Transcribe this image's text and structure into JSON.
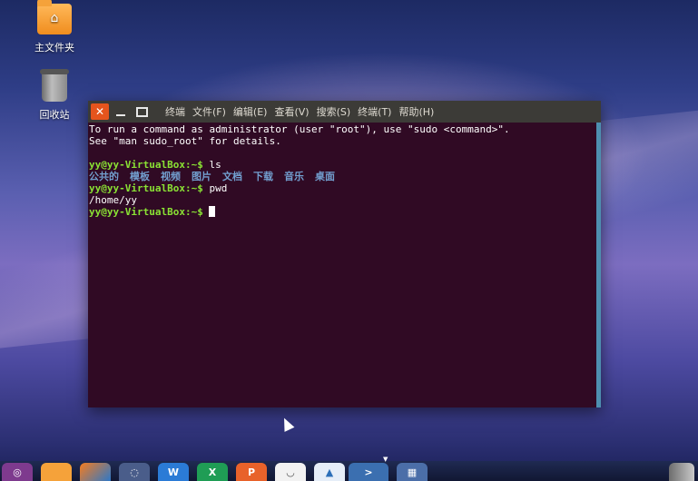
{
  "desktop": {
    "icons": [
      {
        "label": "主文件夹"
      },
      {
        "label": "回收站"
      }
    ]
  },
  "terminal": {
    "title_menu": [
      "终端",
      "文件(F)",
      "编辑(E)",
      "查看(V)",
      "搜索(S)",
      "终端(T)",
      "帮助(H)"
    ],
    "lines": {
      "l1": "To run a command as administrator (user \"root\"), use \"sudo <command>\".",
      "l2": "See \"man sudo_root\" for details.",
      "prompt": "yy@yy-VirtualBox:~$",
      "cmd1": " ls",
      "cmd2": " pwd",
      "pwd_out": "/home/yy",
      "cmd3": " "
    },
    "ls_dirs": [
      "公共的",
      "模板",
      "视频",
      "图片",
      "文档",
      "下载",
      "音乐",
      "桌面"
    ],
    "colors": {
      "background": "#300a24",
      "prompt": "#8ae234",
      "directory": "#729fcf",
      "close_button": "#e5541d"
    }
  },
  "dock": {
    "icons": [
      "ubuntu-icon",
      "files-icon",
      "firefox-icon",
      "settings-icon",
      "word-icon",
      "excel-icon",
      "powerpoint-icon",
      "software-center-icon",
      "update-icon",
      "terminal-icon",
      "workspace-icon",
      "trash-icon"
    ]
  }
}
